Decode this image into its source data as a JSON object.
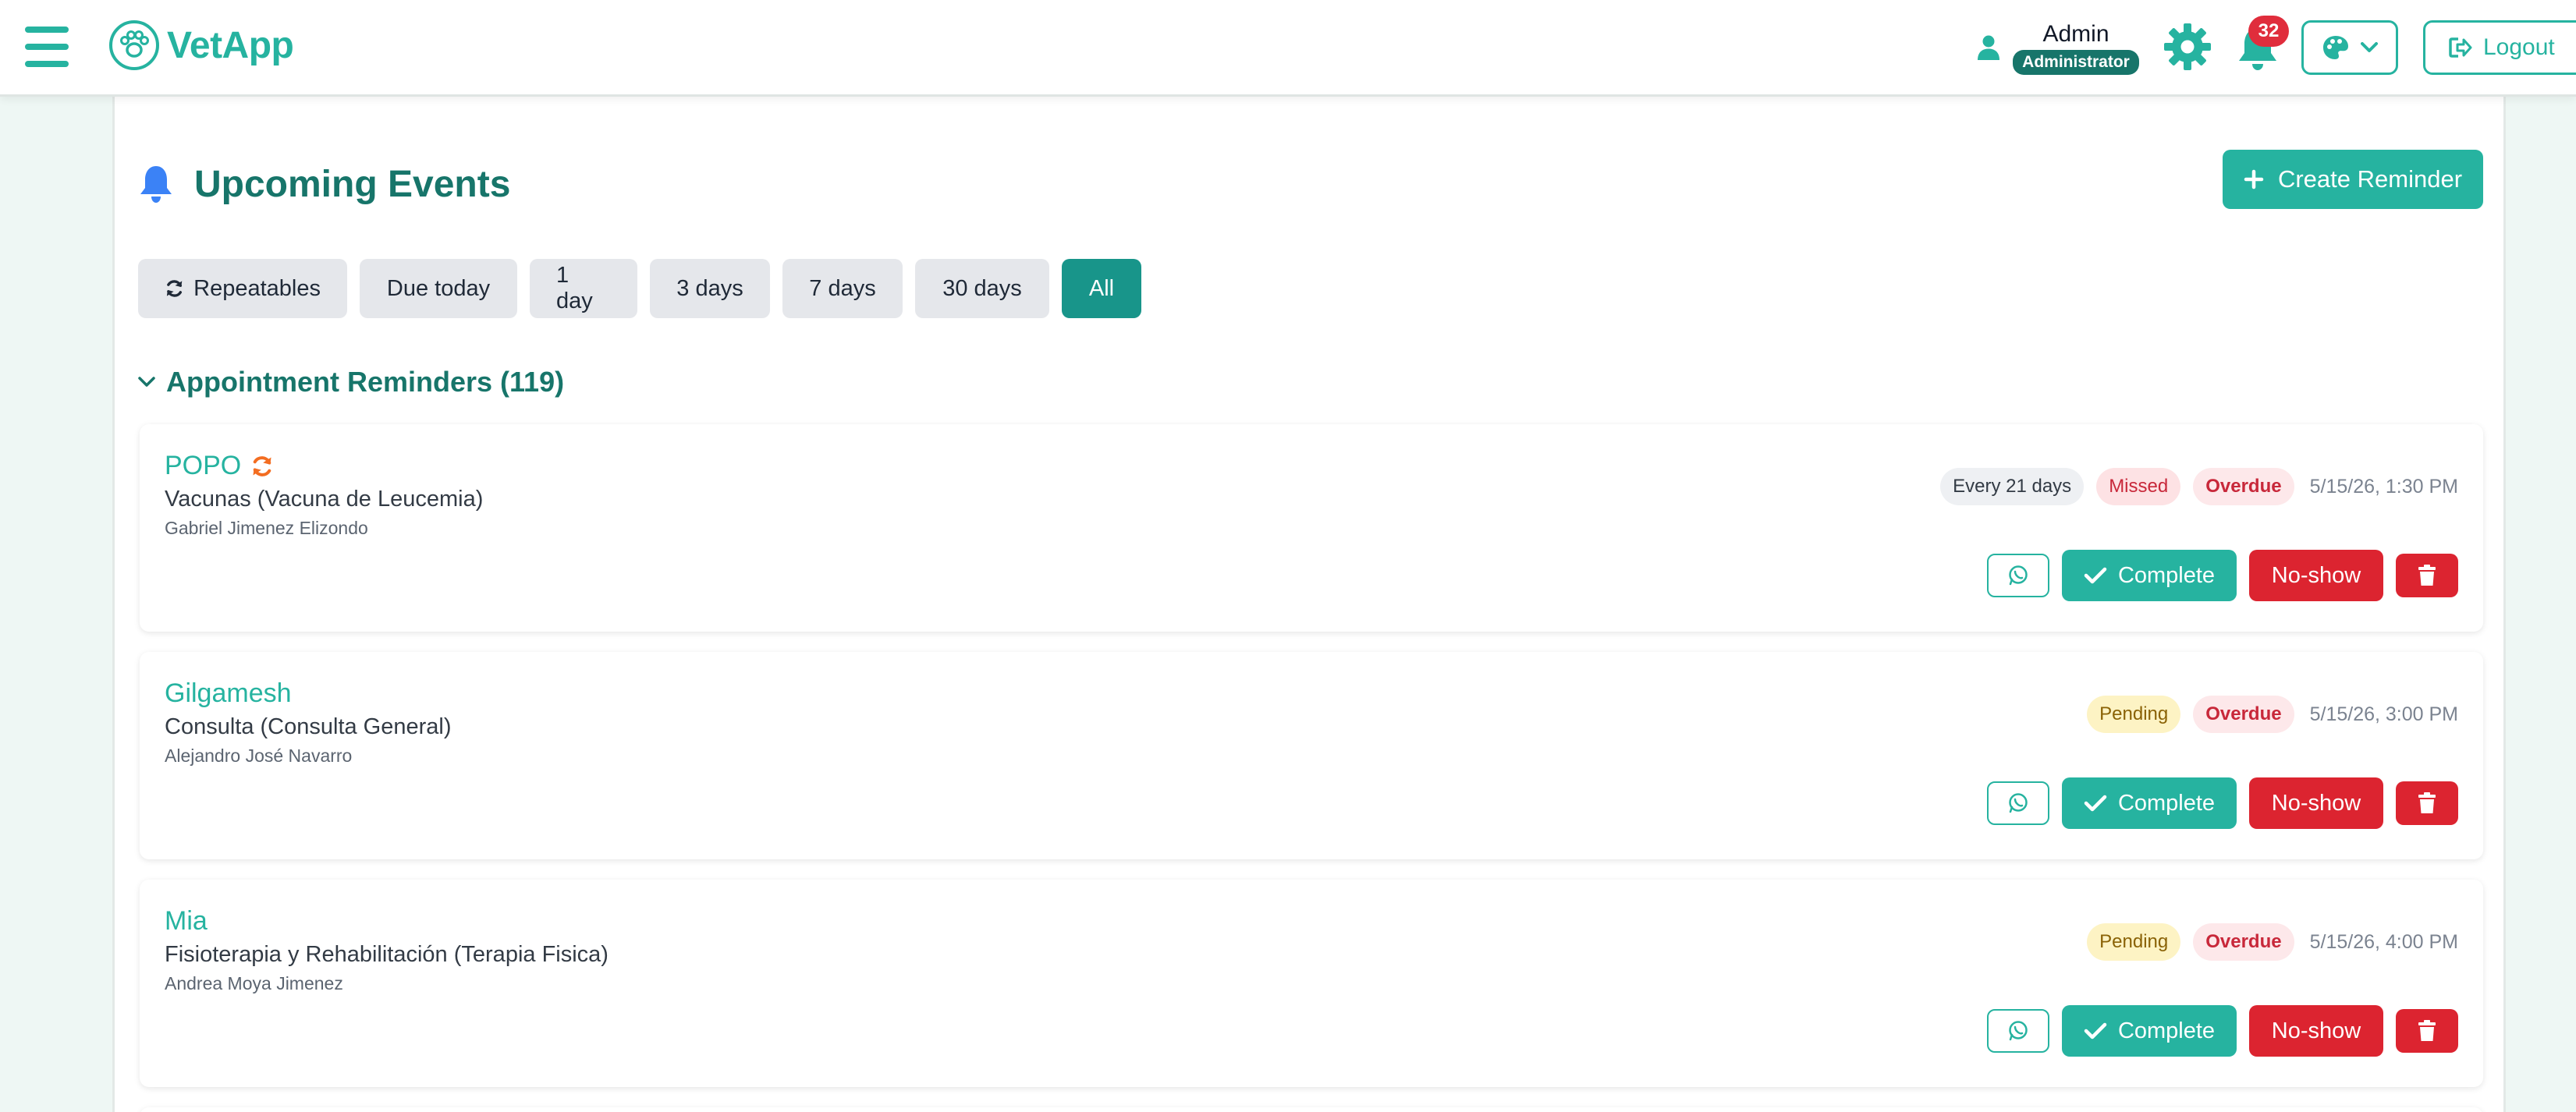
{
  "app": {
    "name": "VetApp"
  },
  "user": {
    "name": "Admin",
    "role": "Administrator"
  },
  "notifications": {
    "count": "32"
  },
  "header": {
    "logout_label": "Logout",
    "menu_icon": "hamburger-menu-icon",
    "settings_icon": "gear-icon",
    "theme_icon": "palette-icon"
  },
  "page": {
    "title": "Upcoming Events",
    "create_label": "Create Reminder"
  },
  "filters": [
    {
      "label": "Repeatables",
      "icon": "sync-icon",
      "active": false
    },
    {
      "label": "Due today",
      "active": false
    },
    {
      "label": "1 day",
      "active": false
    },
    {
      "label": "3 days",
      "active": false
    },
    {
      "label": "7 days",
      "active": false
    },
    {
      "label": "30 days",
      "active": false
    },
    {
      "label": "All",
      "active": true
    }
  ],
  "section": {
    "title": "Appointment Reminders (119)",
    "expanded": true
  },
  "events": [
    {
      "pet": "POPO",
      "repeating": true,
      "service": "Vacunas (Vacuna de Leucemia)",
      "owner": "Gabriel Jimenez Elizondo",
      "repeat_label": "Every 21 days",
      "status": "Missed",
      "overdue": "Overdue",
      "datetime": "5/15/26, 1:30 PM"
    },
    {
      "pet": "Gilgamesh",
      "repeating": false,
      "service": "Consulta (Consulta General)",
      "owner": "Alejandro José Navarro",
      "status": "Pending",
      "overdue": "Overdue",
      "datetime": "5/15/26, 3:00 PM"
    },
    {
      "pet": "Mia",
      "repeating": false,
      "service": "Fisioterapia y Rehabilitación (Terapia Fisica)",
      "owner": "Andrea Moya Jimenez",
      "status": "Pending",
      "overdue": "Overdue",
      "datetime": "5/15/26, 4:00 PM"
    }
  ],
  "actions": {
    "complete_label": "Complete",
    "noshow_label": "No-show"
  },
  "colors": {
    "primary": "#26b3a0",
    "primary_dark": "#17756a",
    "danger": "#dc2430",
    "badge_notify": "#e02d3c"
  }
}
